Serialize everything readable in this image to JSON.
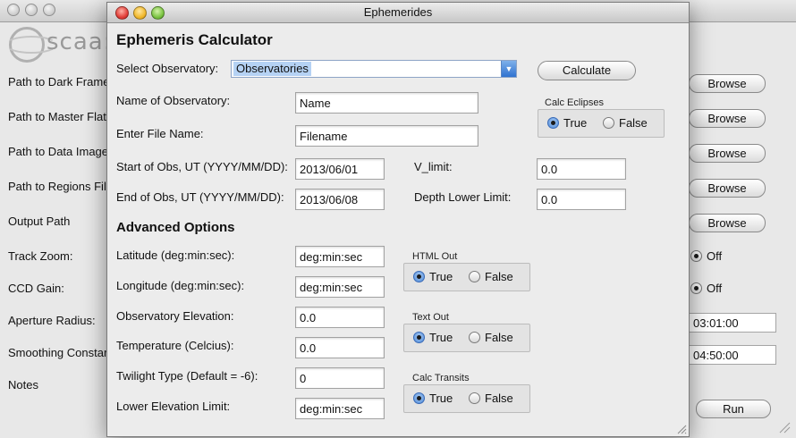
{
  "background_window": {
    "logo_text": "scaa:",
    "labels": [
      "Path to Dark Frame",
      "Path to Master Flat:",
      "Path to Data Image",
      "Path to Regions File",
      "Output Path",
      "Track Zoom:",
      "CCD Gain:",
      "Aperture Radius:",
      "Smoothing Constar",
      "Notes"
    ],
    "browse_label": "Browse",
    "off_label": "Off",
    "field_1": "03:01:00",
    "field_2": "04:50:00",
    "run_label": "Run"
  },
  "dialog": {
    "title": "Ephemerides",
    "heading": "Ephemeris Calculator",
    "select_observatory_label": "Select Observatory:",
    "observatory_value": "Observatories",
    "calculate_label": "Calculate",
    "name_label": "Name of Observatory:",
    "name_value": "Name",
    "file_label": "Enter File Name:",
    "file_value": "Filename",
    "start_label": "Start of Obs, UT (YYYY/MM/DD):",
    "start_value": "2013/06/01",
    "end_label": "End of Obs, UT (YYYY/MM/DD):",
    "end_value": "2013/06/08",
    "vlimit_label": "V_limit:",
    "vlimit_value": "0.0",
    "depth_label": "Depth Lower Limit:",
    "depth_value": "0.0",
    "calc_eclipses": {
      "title": "Calc Eclipses",
      "true_label": "True",
      "false_label": "False",
      "selected": "True"
    },
    "advanced_heading": "Advanced Options",
    "latitude_label": "Latitude (deg:min:sec):",
    "latitude_value": "deg:min:sec",
    "longitude_label": "Longitude (deg:min:sec):",
    "longitude_value": "deg:min:sec",
    "elevation_label": "Observatory Elevation:",
    "elevation_value": "0.0",
    "temperature_label": "Temperature (Celcius):",
    "temperature_value": "0.0",
    "twilight_label": "Twilight Type (Default = -6):",
    "twilight_value": "0",
    "lower_elev_label": "Lower Elevation Limit:",
    "lower_elev_value": "deg:min:sec",
    "html_out": {
      "title": "HTML Out",
      "true_label": "True",
      "false_label": "False",
      "selected": "True"
    },
    "text_out": {
      "title": "Text Out",
      "true_label": "True",
      "false_label": "False",
      "selected": "True"
    },
    "calc_transits": {
      "title": "Calc Transits",
      "true_label": "True",
      "false_label": "False",
      "selected": "True"
    }
  },
  "icons": [
    "close-icon",
    "minimize-icon",
    "zoom-icon",
    "dropdown-arrow-icon",
    "radio-selected-icon",
    "radio-unselected-icon",
    "resize-grip-icon",
    "oscaar-logo-icon"
  ],
  "colors": {
    "selection": "#b5d2f4",
    "radio_on": "#4f8ad8",
    "window_bg": "#ececec"
  }
}
